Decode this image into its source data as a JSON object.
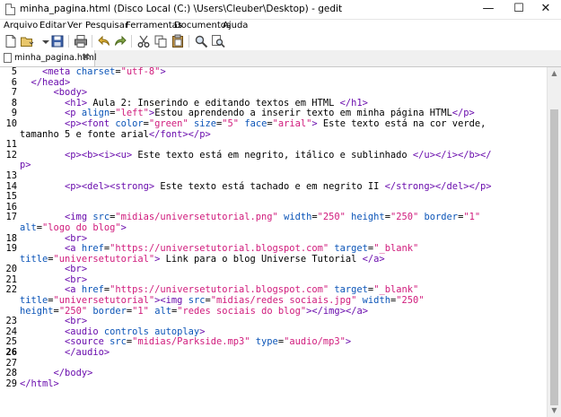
{
  "window": {
    "title": "minha_pagina.html (Disco Local (C:) \\Users\\Cleuber\\Desktop) - gedit"
  },
  "menubar": [
    "Arquivo",
    "Editar",
    "Ver",
    "Pesquisar",
    "Ferramentas",
    "Documentos",
    "Ajuda"
  ],
  "toolbar": {
    "icons": [
      "new-document-icon",
      "open-icon",
      "save-icon",
      "print-icon",
      "undo-icon",
      "redo-icon",
      "cut-icon",
      "copy-icon",
      "paste-icon",
      "find-icon",
      "find-replace-icon"
    ]
  },
  "tab": {
    "label": "minha_pagina.html",
    "close": "✖"
  },
  "editor": {
    "current_line": 26,
    "lines": [
      {
        "num": 5,
        "parts": [
          [
            "    ",
            "x"
          ],
          [
            "<meta ",
            "t"
          ],
          [
            "charset",
            "a"
          ],
          [
            "=",
            "x"
          ],
          [
            "\"utf-8\"",
            "v"
          ],
          [
            ">",
            "t"
          ]
        ]
      },
      {
        "num": 6,
        "parts": [
          [
            "  ",
            "x"
          ],
          [
            "</head>",
            "t"
          ]
        ]
      },
      {
        "num": 7,
        "parts": [
          [
            "      ",
            "x"
          ],
          [
            "<body>",
            "t"
          ]
        ]
      },
      {
        "num": 8,
        "parts": [
          [
            "        ",
            "x"
          ],
          [
            "<h1>",
            "t"
          ],
          [
            " Aula 2: Inserindo e editando textos em HTML ",
            "x"
          ],
          [
            "</h1>",
            "t"
          ]
        ]
      },
      {
        "num": 9,
        "parts": [
          [
            "        ",
            "x"
          ],
          [
            "<p ",
            "t"
          ],
          [
            "align",
            "a"
          ],
          [
            "=",
            "x"
          ],
          [
            "\"left\"",
            "v"
          ],
          [
            ">",
            "t"
          ],
          [
            "Estou aprendendo a inserir texto em minha página HTML",
            "x"
          ],
          [
            "</p>",
            "t"
          ]
        ]
      },
      {
        "num": 10,
        "parts": [
          [
            "        ",
            "x"
          ],
          [
            "<p><font ",
            "t"
          ],
          [
            "color",
            "a"
          ],
          [
            "=",
            "x"
          ],
          [
            "\"green\"",
            "v"
          ],
          [
            " ",
            "x"
          ],
          [
            "size",
            "a"
          ],
          [
            "=",
            "x"
          ],
          [
            "\"5\"",
            "v"
          ],
          [
            " ",
            "x"
          ],
          [
            "face",
            "a"
          ],
          [
            "=",
            "x"
          ],
          [
            "\"arial\"",
            "v"
          ],
          [
            ">",
            "t"
          ],
          [
            " Este texto está na cor verde,",
            "x"
          ]
        ],
        "wrap": [
          [
            "tamanho 5 e fonte arial",
            "x"
          ],
          [
            "</font></p>",
            "t"
          ]
        ]
      },
      {
        "num": 11,
        "parts": []
      },
      {
        "num": 12,
        "parts": [
          [
            "        ",
            "x"
          ],
          [
            "<p><b><i><u>",
            "t"
          ],
          [
            " Este texto está em negrito, itálico e sublinhado ",
            "x"
          ],
          [
            "</u></i></b></",
            "t"
          ]
        ],
        "wrap": [
          [
            "p>",
            "t"
          ]
        ]
      },
      {
        "num": 13,
        "parts": []
      },
      {
        "num": 14,
        "parts": [
          [
            "        ",
            "x"
          ],
          [
            "<p><del><strong>",
            "t"
          ],
          [
            " Este texto está tachado e em negrito II ",
            "x"
          ],
          [
            "</strong></del></p>",
            "t"
          ]
        ]
      },
      {
        "num": 15,
        "parts": []
      },
      {
        "num": 16,
        "parts": []
      },
      {
        "num": 17,
        "parts": [
          [
            "        ",
            "x"
          ],
          [
            "<img ",
            "t"
          ],
          [
            "src",
            "a"
          ],
          [
            "=",
            "x"
          ],
          [
            "\"midias/universetutorial.png\"",
            "v"
          ],
          [
            " ",
            "x"
          ],
          [
            "width",
            "a"
          ],
          [
            "=",
            "x"
          ],
          [
            "\"250\"",
            "v"
          ],
          [
            " ",
            "x"
          ],
          [
            "height",
            "a"
          ],
          [
            "=",
            "x"
          ],
          [
            "\"250\"",
            "v"
          ],
          [
            " ",
            "x"
          ],
          [
            "border",
            "a"
          ],
          [
            "=",
            "x"
          ],
          [
            "\"1\"",
            "v"
          ]
        ],
        "wrap": [
          [
            "alt",
            "a"
          ],
          [
            "=",
            "x"
          ],
          [
            "\"logo do blog\"",
            "v"
          ],
          [
            ">",
            "t"
          ]
        ]
      },
      {
        "num": 18,
        "parts": [
          [
            "        ",
            "x"
          ],
          [
            "<br>",
            "t"
          ]
        ]
      },
      {
        "num": 19,
        "parts": [
          [
            "        ",
            "x"
          ],
          [
            "<a ",
            "t"
          ],
          [
            "href",
            "a"
          ],
          [
            "=",
            "x"
          ],
          [
            "\"https://universetutorial.blogspot.com\"",
            "v"
          ],
          [
            " ",
            "x"
          ],
          [
            "target",
            "a"
          ],
          [
            "=",
            "x"
          ],
          [
            "\"_blank\"",
            "v"
          ]
        ],
        "wrap": [
          [
            "title",
            "a"
          ],
          [
            "=",
            "x"
          ],
          [
            "\"universetutorial\"",
            "v"
          ],
          [
            ">",
            "t"
          ],
          [
            " Link para o blog Universe Tutorial ",
            "x"
          ],
          [
            "</a>",
            "t"
          ]
        ]
      },
      {
        "num": 20,
        "parts": [
          [
            "        ",
            "x"
          ],
          [
            "<br>",
            "t"
          ]
        ]
      },
      {
        "num": 21,
        "parts": [
          [
            "        ",
            "x"
          ],
          [
            "<br>",
            "t"
          ]
        ]
      },
      {
        "num": 22,
        "parts": [
          [
            "        ",
            "x"
          ],
          [
            "<a ",
            "t"
          ],
          [
            "href",
            "a"
          ],
          [
            "=",
            "x"
          ],
          [
            "\"https://universetutorial.blogspot.com\"",
            "v"
          ],
          [
            " ",
            "x"
          ],
          [
            "target",
            "a"
          ],
          [
            "=",
            "x"
          ],
          [
            "\"_blank\"",
            "v"
          ]
        ],
        "wrap": [
          [
            "title",
            "a"
          ],
          [
            "=",
            "x"
          ],
          [
            "\"universetutorial\"",
            "v"
          ],
          [
            "><img ",
            "t"
          ],
          [
            "src",
            "a"
          ],
          [
            "=",
            "x"
          ],
          [
            "\"midias/redes sociais.jpg\"",
            "v"
          ],
          [
            " ",
            "x"
          ],
          [
            "width",
            "a"
          ],
          [
            "=",
            "x"
          ],
          [
            "\"250\"",
            "v"
          ]
        ],
        "wrap2": [
          [
            "height",
            "a"
          ],
          [
            "=",
            "x"
          ],
          [
            "\"250\"",
            "v"
          ],
          [
            " ",
            "x"
          ],
          [
            "border",
            "a"
          ],
          [
            "=",
            "x"
          ],
          [
            "\"1\"",
            "v"
          ],
          [
            " ",
            "x"
          ],
          [
            "alt",
            "a"
          ],
          [
            "=",
            "x"
          ],
          [
            "\"redes sociais do blog\"",
            "v"
          ],
          [
            "></img></a>",
            "t"
          ]
        ]
      },
      {
        "num": 23,
        "parts": [
          [
            "        ",
            "x"
          ],
          [
            "<br>",
            "t"
          ]
        ]
      },
      {
        "num": 24,
        "parts": [
          [
            "        ",
            "x"
          ],
          [
            "<audio ",
            "t"
          ],
          [
            "controls autoplay",
            "a"
          ],
          [
            ">",
            "t"
          ]
        ]
      },
      {
        "num": 25,
        "parts": [
          [
            "        ",
            "x"
          ],
          [
            "<source ",
            "t"
          ],
          [
            "src",
            "a"
          ],
          [
            "=",
            "x"
          ],
          [
            "\"midias/Parkside.mp3\"",
            "v"
          ],
          [
            " ",
            "x"
          ],
          [
            "type",
            "a"
          ],
          [
            "=",
            "x"
          ],
          [
            "\"audio/mp3\"",
            "v"
          ],
          [
            ">",
            "t"
          ]
        ]
      },
      {
        "num": 26,
        "parts": [
          [
            "        ",
            "x"
          ],
          [
            "</audio>",
            "t"
          ]
        ]
      },
      {
        "num": 27,
        "parts": []
      },
      {
        "num": 28,
        "parts": [
          [
            "      ",
            "x"
          ],
          [
            "</body>",
            "t"
          ]
        ]
      },
      {
        "num": 29,
        "parts": [
          [
            "</html>",
            "t"
          ]
        ]
      }
    ]
  }
}
